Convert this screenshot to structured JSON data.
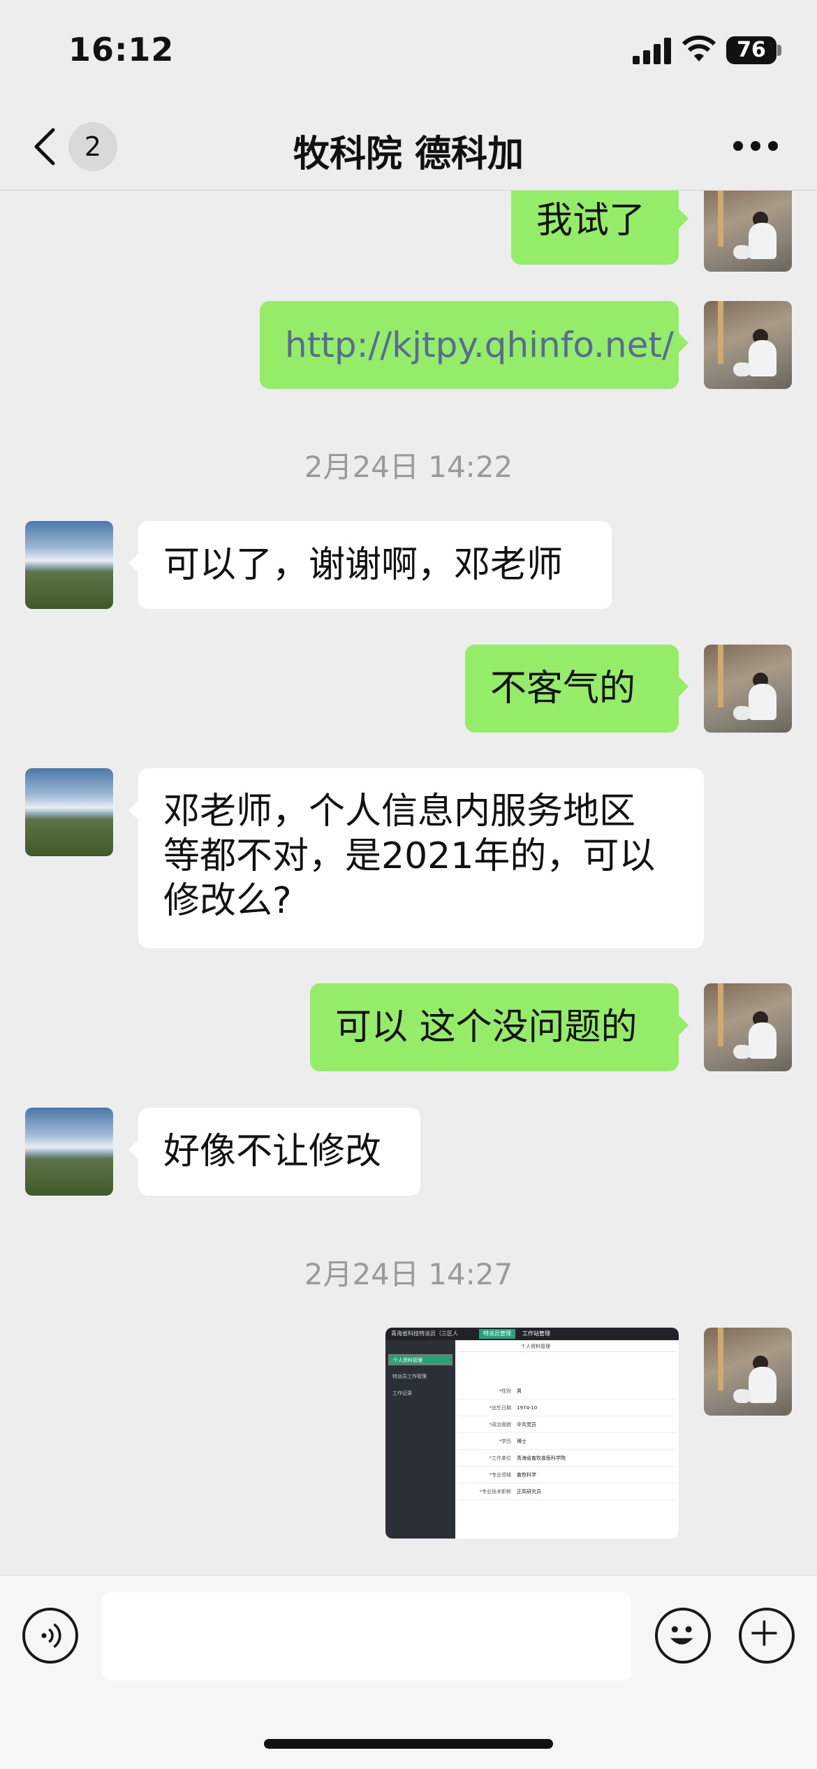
{
  "status_bar": {
    "time": "16:12",
    "battery": "76"
  },
  "nav": {
    "back_count": "2",
    "title": "牧科院 德科加"
  },
  "messages": [
    {
      "side": "right",
      "text": "我试了"
    },
    {
      "side": "right",
      "text": "http://kjtpy.qhinfo.net/",
      "type": "link"
    },
    {
      "type": "timestamp",
      "text": "2月24日 14:22"
    },
    {
      "side": "left",
      "text": "可以了，谢谢啊，邓老师"
    },
    {
      "side": "right",
      "text": "不客气的"
    },
    {
      "side": "left",
      "lines": [
        "邓老师，个人信息内服务地区",
        "等都不对，是2021年的，可以",
        "修改么?"
      ]
    },
    {
      "side": "right",
      "text": "可以 这个没问题的"
    },
    {
      "side": "left",
      "text": "好像不让修改"
    },
    {
      "type": "timestamp",
      "text": "2月24日 14:27"
    },
    {
      "side": "right",
      "type": "image"
    }
  ],
  "screenshot_thumb": {
    "app_title": "青海省科技特派员（三区人",
    "tabs": [
      "特派员管理",
      "工作站管理"
    ],
    "subtab": "个人资料管理",
    "menu": [
      "个人资料管理",
      "特派员工作管理",
      "工作记录"
    ],
    "rows": [
      {
        "label": "*性别",
        "value": "男"
      },
      {
        "label": "*出生日期",
        "value": "1974-10"
      },
      {
        "label": "*政治面貌",
        "value": "中共党员"
      },
      {
        "label": "*学历",
        "value": "博士"
      },
      {
        "label": "*工作单位",
        "value": "青海省畜牧兽医科学院"
      },
      {
        "label": "*专业领域",
        "value": "畜牧科学"
      },
      {
        "label": "*专业技术职称",
        "value": "正高研究员"
      }
    ]
  },
  "colors": {
    "right_bubble": "#95ec69",
    "left_bubble": "#ffffff",
    "link": "#576b95",
    "background": "#ededed"
  }
}
